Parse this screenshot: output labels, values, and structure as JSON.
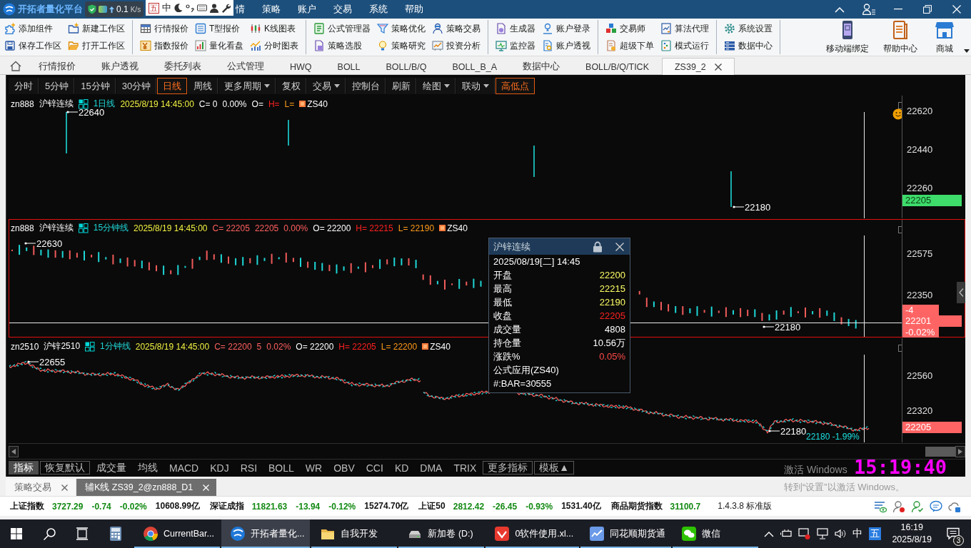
{
  "title_bar": {
    "app_title": "开拓者量化平台",
    "net_speed": {
      "value": "0.1",
      "unit": "K/s"
    },
    "ime_bar": [
      "五",
      "中"
    ],
    "menu": [
      "情",
      "策略",
      "账户",
      "交易",
      "系统",
      "帮助"
    ]
  },
  "toolbar": {
    "groups": [
      [
        "添加组件",
        "保存工作区",
        "新建工作区",
        "打开工作区"
      ],
      [
        "行情报价",
        "指数报价",
        "T型报价",
        "量化看盘",
        "K线图表",
        "分时图表"
      ],
      [
        "公式管理器",
        "策略选股",
        "策略优化",
        "策略研究",
        "策略交易",
        "投资分析"
      ],
      [
        "生成器",
        "监控器",
        "账户登录",
        "账户透视"
      ],
      [
        "交易师",
        "超级下单",
        "算法代理",
        "模式运行"
      ],
      [
        "系统设置",
        "数据中心"
      ]
    ],
    "large_buttons": [
      "移动端绑定",
      "帮助中心",
      "商城"
    ]
  },
  "tabs": [
    {
      "label": "行情报价",
      "selected": false,
      "closable": false
    },
    {
      "label": "账户透视",
      "selected": false,
      "closable": false
    },
    {
      "label": "委托列表",
      "selected": false,
      "closable": false
    },
    {
      "label": "公式管理",
      "selected": false,
      "closable": false
    },
    {
      "label": "HWQ",
      "selected": false,
      "closable": false
    },
    {
      "label": "BOLL",
      "selected": false,
      "closable": false
    },
    {
      "label": "BOLL/B/Q",
      "selected": false,
      "closable": false
    },
    {
      "label": "BOLL_B_A",
      "selected": false,
      "closable": false
    },
    {
      "label": "数据中心",
      "selected": false,
      "closable": false
    },
    {
      "label": "BOLL/B/Q/TICK",
      "selected": false,
      "closable": false
    },
    {
      "label": "ZS39_2",
      "selected": true,
      "closable": true
    }
  ],
  "chart_toolbar": [
    {
      "label": "分时",
      "selected": false,
      "dropdown": false
    },
    {
      "label": "5分钟",
      "selected": false,
      "dropdown": false
    },
    {
      "label": "15分钟",
      "selected": false,
      "dropdown": false
    },
    {
      "label": "30分钟",
      "selected": false,
      "dropdown": false
    },
    {
      "label": "日线",
      "selected": true,
      "dropdown": false
    },
    {
      "label": "周线",
      "selected": false,
      "dropdown": false
    },
    {
      "label": "更多周期",
      "selected": false,
      "dropdown": true
    },
    {
      "label": "复权",
      "selected": false,
      "dropdown": false
    },
    {
      "label": "交易",
      "selected": false,
      "dropdown": true
    },
    {
      "label": "控制台",
      "selected": false,
      "dropdown": false
    },
    {
      "label": "刷新",
      "selected": false,
      "dropdown": false
    },
    {
      "label": "绘图",
      "selected": false,
      "dropdown": true
    },
    {
      "label": "联动",
      "selected": false,
      "dropdown": true
    },
    {
      "label": "高低点",
      "selected": true,
      "dropdown": false
    }
  ],
  "panes": [
    {
      "symbol": "zn888",
      "name": "沪锌连续",
      "period": "1日线",
      "time": "2025/8/19 14:45:00",
      "fields": [
        {
          "text": "C= 0",
          "color": "#ffffff"
        },
        {
          "text": "0.00%",
          "color": "#ffffff"
        },
        {
          "text": "O=",
          "color": "#ffffff"
        },
        {
          "text": "H=",
          "color": "#ff2020"
        },
        {
          "text": "L=",
          "color": "#ff9a1a"
        }
      ],
      "formula": "ZS40",
      "axis": [
        "22620",
        "22440",
        "22260"
      ],
      "price_tag": {
        "lines": [
          "22205"
        ],
        "color": "#3ddc6b"
      },
      "markers": [
        "22640",
        "22180"
      ],
      "selected": false
    },
    {
      "symbol": "zn888",
      "name": "沪锌连续",
      "period": "15分钟线",
      "time": "2025/8/19 14:45:00",
      "fields": [
        {
          "text": "C= 22205",
          "color": "#ff5f5f"
        },
        {
          "text": "22205",
          "color": "#ff5f5f"
        },
        {
          "text": "0.00%",
          "color": "#ff5f5f"
        },
        {
          "text": "O= 22200",
          "color": "#ffffff"
        },
        {
          "text": "H= 22215",
          "color": "#ff2020"
        },
        {
          "text": "L= 22190",
          "color": "#ff9a1a"
        }
      ],
      "formula": "ZS40",
      "axis": [
        "22575",
        "22350"
      ],
      "price_tag": {
        "lines": [
          "-4",
          "22201",
          "-0.02%"
        ],
        "color": "#ff6464"
      },
      "markers": [
        "22630",
        "22180"
      ],
      "selected": true
    },
    {
      "symbol": "zn2510",
      "name": "沪锌2510",
      "period": "1分钟线",
      "time": "2025/8/19 14:45:00",
      "fields": [
        {
          "text": "C= 22200",
          "color": "#ff5f5f"
        },
        {
          "text": "5",
          "color": "#ff5f5f"
        },
        {
          "text": "0.02%",
          "color": "#ff5f5f"
        },
        {
          "text": "O= 22200",
          "color": "#ffffff"
        },
        {
          "text": "H= 22205",
          "color": "#ff2020"
        },
        {
          "text": "L= 22200",
          "color": "#ff9a1a"
        }
      ],
      "formula": "ZS40",
      "axis": [
        "22560",
        "22320"
      ],
      "price_tag": {
        "lines": [
          "22205"
        ],
        "color": "#ff6464"
      },
      "markers": [
        "22655",
        "22180"
      ],
      "note": "22180 -1.99%",
      "selected": false
    }
  ],
  "tooltip": {
    "title": "沪锌连续",
    "datetime": "2025/08/19[二] 14:45",
    "rows": [
      {
        "label": "开盘",
        "value": "22200",
        "color": "#ffff66"
      },
      {
        "label": "最高",
        "value": "22215",
        "color": "#ffff66"
      },
      {
        "label": "最低",
        "value": "22190",
        "color": "#ffff66"
      },
      {
        "label": "收盘",
        "value": "22205",
        "color": "#ff2020"
      },
      {
        "label": "成交量",
        "value": "4808",
        "color": "#ffffff"
      },
      {
        "label": "持仓量",
        "value": "10.56万",
        "color": "#ffffff"
      },
      {
        "label": "涨跌%",
        "value": "0.05%",
        "color": "#ff4a4a"
      }
    ],
    "lines": [
      "公式应用(ZS40)",
      "#:BAR=30555"
    ]
  },
  "indicator_bar": [
    {
      "label": "指标",
      "kind": "tab",
      "selected": true
    },
    {
      "label": "恢复默认",
      "kind": "button",
      "selected": false
    },
    {
      "label": "成交量",
      "kind": "indicator",
      "selected": false
    },
    {
      "label": "均线",
      "kind": "indicator",
      "selected": false
    },
    {
      "label": "MACD",
      "kind": "indicator",
      "selected": false
    },
    {
      "label": "KDJ",
      "kind": "indicator",
      "selected": false
    },
    {
      "label": "RSI",
      "kind": "indicator",
      "selected": false
    },
    {
      "label": "BOLL",
      "kind": "indicator",
      "selected": false
    },
    {
      "label": "WR",
      "kind": "indicator",
      "selected": false
    },
    {
      "label": "OBV",
      "kind": "indicator",
      "selected": false
    },
    {
      "label": "CCI",
      "kind": "indicator",
      "selected": false
    },
    {
      "label": "KD",
      "kind": "indicator",
      "selected": false
    },
    {
      "label": "DMA",
      "kind": "indicator",
      "selected": false
    },
    {
      "label": "TRIX",
      "kind": "indicator",
      "selected": false
    },
    {
      "label": "更多指标",
      "kind": "button",
      "selected": false
    },
    {
      "label": "模板▲",
      "kind": "button",
      "selected": false
    }
  ],
  "bottom_tabs": [
    {
      "label": "策略交易",
      "selected": false
    },
    {
      "label": "辅K线 ZS39_2@zn888_D1",
      "selected": true
    }
  ],
  "status_bar": {
    "indices": [
      {
        "name": "上证指数",
        "values": [
          "3727.29",
          "-0.74",
          "-0.02%"
        ],
        "turnover": "10608.99亿",
        "color": "#138a13"
      },
      {
        "name": "深证成指",
        "values": [
          "11821.63",
          "-13.94",
          "-0.12%"
        ],
        "turnover": "15274.70亿",
        "color": "#138a13"
      },
      {
        "name": "上证50",
        "values": [
          "2812.42",
          "-26.45",
          "-0.93%"
        ],
        "turnover": "1531.40亿",
        "color": "#138a13"
      },
      {
        "name": "商品期货指数",
        "values": [
          "31100.7"
        ],
        "color": "#138a13"
      }
    ],
    "version": "1.4.3.8 标准版"
  },
  "os_notice": {
    "title": "激活 Windows",
    "text": "转到“设置”以激活 Windows。"
  },
  "desktop_clock": "15:19:40",
  "taskbar": {
    "apps": [
      {
        "running": false,
        "selected": false
      },
      {
        "label": "CurrentBar...",
        "running": true,
        "selected": false
      },
      {
        "label": "开拓者量化...",
        "running": true,
        "selected": true
      },
      {
        "label": "自我开发",
        "running": true,
        "selected": false
      },
      {
        "label": "新加卷 (D:)",
        "running": true,
        "selected": false
      },
      {
        "label": "0软件使用.xl...",
        "running": true,
        "selected": false
      },
      {
        "label": "同花顺期货通",
        "running": true,
        "selected": false
      },
      {
        "label": "微信",
        "running": true,
        "selected": false
      }
    ],
    "tray": {
      "ime": [
        "中",
        "五"
      ],
      "time": "16:19",
      "date": "2025/8/19",
      "notifications": "3"
    }
  }
}
